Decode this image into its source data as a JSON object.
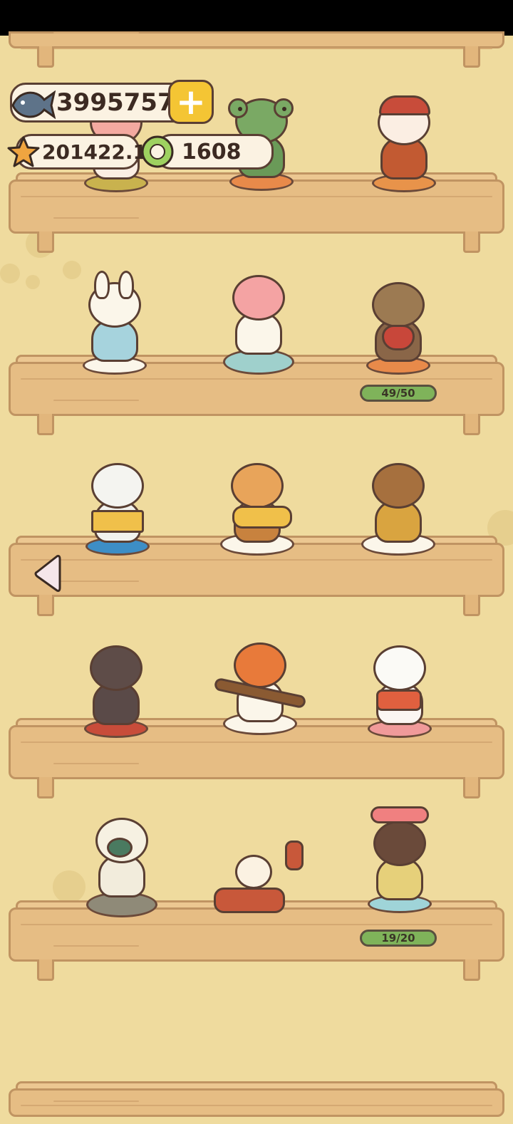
{
  "hud": {
    "fish_count": "39957577",
    "star_count": "201422.1",
    "token_count": "1608",
    "add_symbol": "+"
  },
  "icons": {
    "fish": "fish-icon",
    "star": "star-icon",
    "token": "token-icon",
    "add": "plus-icon",
    "back": "chevron-left-icon"
  },
  "colors": {
    "background": "#efdb9e",
    "shelf": "#e6bd84",
    "progress_fill": "#7fb35a",
    "accent_gold": "#f4c534"
  },
  "shelves": [
    {
      "row": 1,
      "progress": null
    },
    {
      "row": 2,
      "progress": "49/50",
      "progress_value": 0.98
    },
    {
      "row": 3,
      "progress": null
    },
    {
      "row": 4,
      "progress": null
    },
    {
      "row": 5,
      "progress": "19/20",
      "progress_value": 0.95
    },
    {
      "row": 6,
      "progress": null
    }
  ]
}
